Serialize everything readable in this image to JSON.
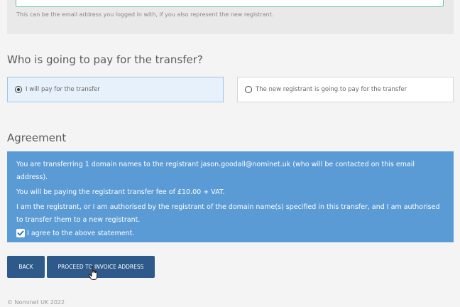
{
  "email_panel": {
    "hint": "This can be the email address you logged in with, if you also represent the new registrant."
  },
  "payment": {
    "heading": "Who is going to pay for the transfer?",
    "options": [
      {
        "label": "I will pay for the transfer",
        "selected": true
      },
      {
        "label": "The new registrant is going to pay for the transfer",
        "selected": false
      }
    ]
  },
  "agreement": {
    "heading": "Agreement",
    "statement_1": "You are transferring 1 domain names to the registrant jason.goodall@nominet.uk (who will be contacted on this email address).",
    "statement_2": "You will be paying the registrant transfer fee of £10.00 + VAT.",
    "statement_3": "I am the registrant, or I am authorised by the registrant of the domain name(s) specified in this transfer, and I am authorised to transfer them to a new registrant.",
    "checkbox_label": "I agree to the above statement.",
    "checkbox_checked": true
  },
  "buttons": {
    "back": "BACK",
    "proceed": "PROCEED TO INVOICE ADDRESS"
  },
  "footer": {
    "copyright": "© Nominet UK 2022"
  },
  "colors": {
    "agreement_bg": "#5b9bd5",
    "button_bg": "#2d5a8a",
    "selected_option_bg": "#e7f1fb"
  }
}
